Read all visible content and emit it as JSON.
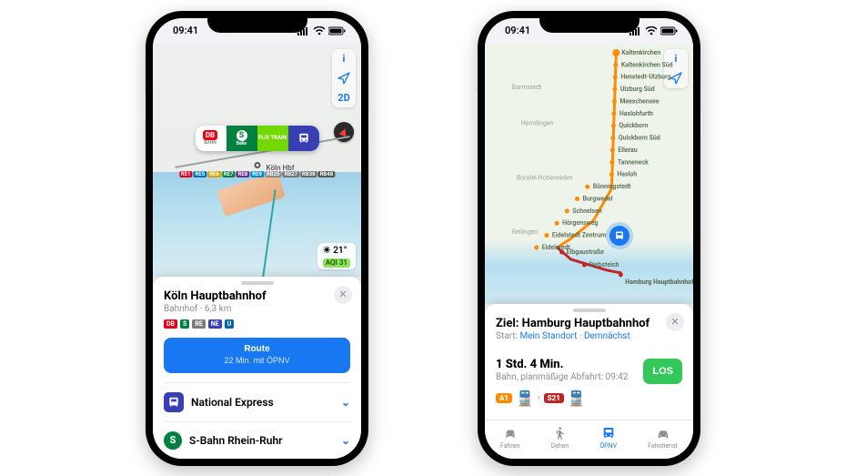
{
  "status_bar": {
    "time": "09:41"
  },
  "left": {
    "map": {
      "controls": {
        "info": "i",
        "dim": "2D"
      },
      "station_label": "Köln Hbf",
      "providers": {
        "db": "BAHN",
        "sbahn": "Bahn",
        "flix": "FLIX TRAIN"
      },
      "line_chips": [
        "RE1",
        "RE5",
        "RE6",
        "RE7",
        "RE8",
        "RE9",
        "RB25",
        "RB27",
        "RB38",
        "RB48"
      ],
      "weather": {
        "temp": "21°",
        "aqi": "AQI 31"
      }
    },
    "sheet": {
      "title": "Köln Hauptbahnhof",
      "subtitle": "Bahnhof · 6,3 km",
      "route_btn": {
        "label": "Route",
        "sub": "22 Min. mit ÖPNV"
      },
      "rows": [
        {
          "id": "national-express",
          "label": "National Express"
        },
        {
          "id": "s-bahn-rhein-ruhr",
          "label": "S-Bahn Rhein-Ruhr"
        }
      ]
    }
  },
  "right": {
    "map": {
      "controls": {
        "info": "i"
      },
      "stops": [
        "Kaltenkirchen",
        "Kaltenkirchen Süd",
        "Henstedt-Ulzburg",
        "Ulzburg Süd",
        "Meeschensee",
        "Haslohfurth",
        "Quickborn",
        "Quickborn Süd",
        "Ellerau",
        "Tanneneck",
        "Hasloh",
        "Bönningstedt",
        "Burgwedel",
        "Schnelsen",
        "Hörgensweg",
        "Eidelstedt Zentrum",
        "Eidelstedt"
      ],
      "route_b_stops": [
        "Elbgaustraße",
        "Diebsteich",
        "Hamburg Hauptbahnhof"
      ],
      "background_labels": [
        "Barmstedt",
        "Hemdingen",
        "Borstel-Hohenraden",
        "Rellingen"
      ]
    },
    "sheet": {
      "title": "Ziel: Hamburg Hauptbahnhof",
      "subtitle_prefix": "Start: ",
      "subtitle_link1": "Mein Standort",
      "subtitle_sep": " · ",
      "subtitle_link2": "Demnächst",
      "duration": "1 Std. 4 Min.",
      "departure": "Bahn, planmäßige Abfahrt: 09:42",
      "pills": {
        "a1": "A1",
        "s21": "S21"
      },
      "go": "LOS",
      "tabs": {
        "drive": "Fahren",
        "walk": "Gehen",
        "transit": "ÖPNV",
        "ride": "Fahrdienst"
      }
    }
  }
}
